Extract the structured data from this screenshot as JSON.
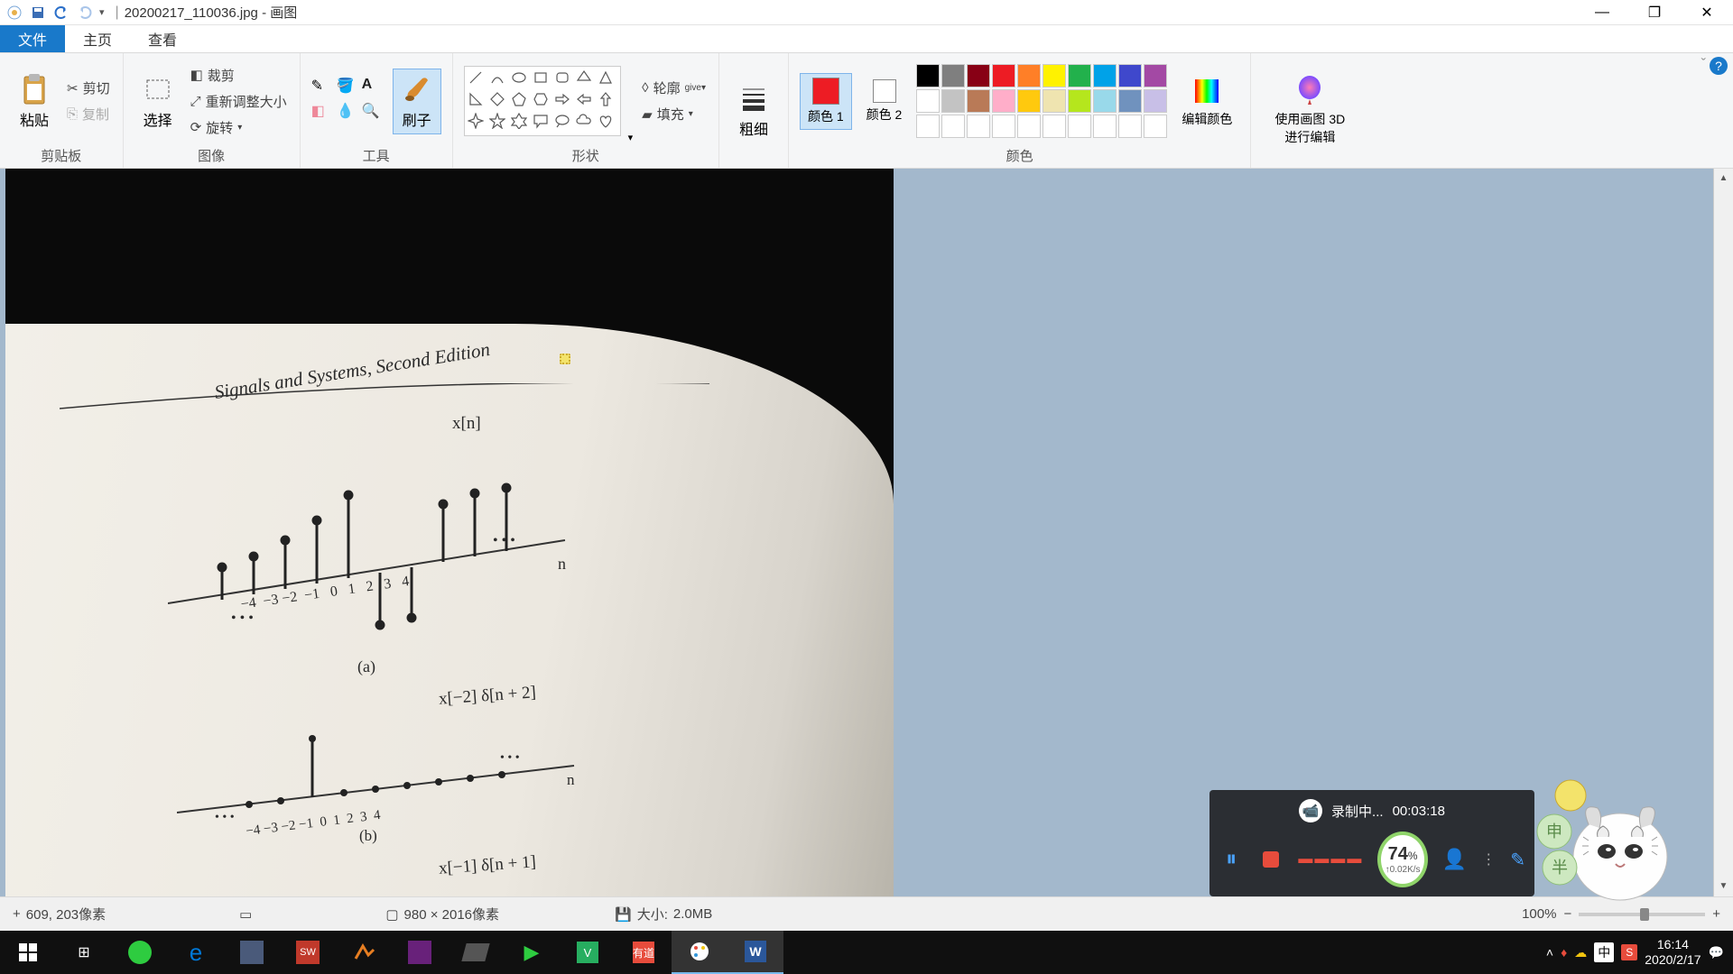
{
  "titlebar": {
    "filename": "20200217_110036.jpg",
    "app": "画图",
    "separator": " - "
  },
  "qat": {
    "save": "save",
    "undo": "undo",
    "redo": "redo"
  },
  "winbtns": {
    "min": "—",
    "max": "❐",
    "close": "✕"
  },
  "tabs": {
    "file": "文件",
    "home": "主页",
    "view": "查看"
  },
  "ribbon": {
    "clipboard": {
      "paste": "粘贴",
      "cut": "剪切",
      "copy": "复制",
      "group": "剪贴板"
    },
    "image": {
      "select": "选择",
      "crop": "裁剪",
      "resize": "重新调整大小",
      "rotate": "旋转",
      "group": "图像"
    },
    "tools": {
      "brush": "刷子",
      "group": "工具"
    },
    "shapes": {
      "outline": "轮廓",
      "fill": "填充",
      "group": "形状"
    },
    "size": {
      "label": "粗细",
      "group": ""
    },
    "colors": {
      "c1": "颜色 1",
      "c2": "颜色 2",
      "edit": "编辑颜色",
      "group": "颜色"
    },
    "paint3d": {
      "label": "使用画图 3D 进行编辑"
    }
  },
  "palette": [
    "#000000",
    "#7f7f7f",
    "#880015",
    "#ed1c24",
    "#ff7f27",
    "#fff200",
    "#22b14c",
    "#00a2e8",
    "#3f48cc",
    "#a349a4",
    "#ffffff",
    "#c3c3c3",
    "#b97a57",
    "#ffaec9",
    "#ffc90e",
    "#efe4b0",
    "#b5e61d",
    "#99d9ea",
    "#7092be",
    "#c8bfe7"
  ],
  "book": {
    "header": "Signals and Systems, Second Edition",
    "fig_a_label": "x[n]",
    "axis_n": "n",
    "fig_a_caption": "(a)",
    "fig_b_label": "x[−2] δ[n + 2]",
    "fig_b_caption": "(b)",
    "fig_c_label": "x[−1] δ[n + 1]",
    "ticks": [
      "−4",
      "−3",
      "−2",
      "−1",
      "0",
      "1",
      "2",
      "3",
      "4"
    ],
    "dots": "• • •"
  },
  "status": {
    "pos_icon": "+",
    "pos": "609, 203像素",
    "dims": "980 × 2016像素",
    "size_label": "大小:",
    "size": "2.0MB",
    "zoom": "100%"
  },
  "recorder": {
    "status": "录制中...",
    "time": "00:03:18",
    "pct": "74",
    "pct_unit": "%",
    "rate": "↑0.02K/s"
  },
  "tray": {
    "ime": "中",
    "time": "16:14",
    "date": "2020/2/17"
  }
}
